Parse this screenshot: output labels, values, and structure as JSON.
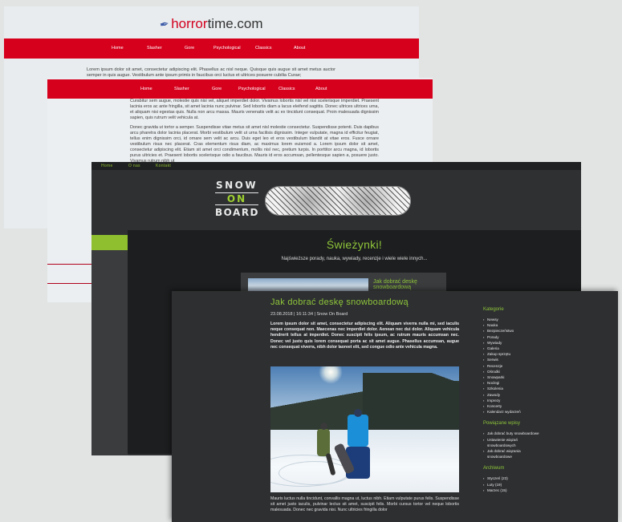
{
  "horror": {
    "logo_prefix": "horror",
    "logo_suffix": "time.com",
    "nav": [
      "Home",
      "Slasher",
      "Gore",
      "Psychological",
      "Classics",
      "About"
    ],
    "paragraph_1": "Lorem ipsum dolor sit amet, consectetur adipiscing elit. Phasellus ac nisl neque. Quisque quis augue sit amet metus auctor semper in quis augue. Vestibulum ante ipsum primis in faucibus orci luctus et ultrices posuere cubilia Curae;",
    "paragraph_2": "Curabitur sem augue, molestie quis nisi vel, aliquet imperdiet dolor. Vivamus lobortis nisl vel nisi scelerisque imperdiet. Praesent lacinia eros ac ante fringilla, sit amet lacinia nunc pulvinar. Sed lobortis diam a lacus eleifend sagittis. Donec ultrices ultrices urna, et aliquam nisi egestas quis. Nulla non arcu massa. Mauris venenatis velit ac ex tincidunt consequat. Proin malesuada dignissim sapien, quis rutrum velit vehicula at.",
    "paragraph_3": "Donec gravida ut tortor a semper. Suspendisse vitae metus sit amet nisl molestie consectetur. Suspendisse potenti. Duis dapibus arcu pharetra dolor lacinia placerat. Morbi vestibulum velit ut urna facilisis dignissim. Integer vulputate, magna id efficitur feugiat, tellus enim dignissim orci, id ornare sem velit ac arcu. Duis eget leo et eros vestibulum blandit at vitae eros. Fusce ornare vestibulum risus nec placerat. Cras elementum risus diam, ac maximus lorem euismod a. Lorem ipsum dolor sit amet, consectetur adipiscing elit. Etiam sit amet orci condimentum, mollis nisl nec, pretium turpis. In porttitor arcu magna, id lobortis purus ultricies et. Praesent lobortis scelerisque odio a faucibus. Mauris id eros accumsan, pellentesque sapien a, posuere justo. Vivamus rutrum nibh ut"
  },
  "snow": {
    "topnav": [
      "Home",
      "O nas",
      "Kontakt"
    ],
    "logo_line1": "SNOW",
    "logo_line2": "ON",
    "logo_line3": "BOARD"
  },
  "swiezynki": {
    "title": "Świeżynki!",
    "subtitle": "Najświeższe porady, nauka, wywiady, recenzje i wiele wiele innych...",
    "card_title": "Jak dobrać deskę snowboardową"
  },
  "article": {
    "title": "Jak dobrać deskę snowboardową",
    "meta": "23.08.2018 | 16:11:34 | Snow On Board",
    "lead": "Lorem ipsum dolor sit amet, consectetur adipiscing elit. Aliquam viverra nulla mi, sed iaculis neque consequat non. Maecenas nec imperdiet dolor. Aenean nec dui dolor. Aliquam vehicula hendrerit tellus at imperdiet. Donec suscipit felis ipsum, ac rutrum mauris accumsan nec. Donec vel justo quis lorem consequat porta ac sit amet augue. Phasellus accumsan, augue nec consequat viverra, nibh dolor laoreet elit, sed congue odio ante vehicula magna.",
    "body": "Mauris luctus nulla tincidunt, convallis magna ut, luctus nibh. Etiam vulputate purus felis. Suspendisse sit amet justo iaculis, pulvinar lectus sit amet, suscipit felis. Morbi cursus tortor vel neque lobortis malesuada. Donec nec gravida nisi. Nunc ultricies fringilla dolor"
  },
  "sidebar": {
    "categories_heading": "Kategorie",
    "categories": [
      "Newsy",
      "Nauka",
      "Bezpieczeństwo",
      "Porady",
      "Wywiady",
      "Galeria",
      "Zakup sprzętu",
      "Serwis",
      "Recenzje",
      "Ośrodki",
      "Snowparki",
      "Noclegi",
      "Szkolenia",
      "Zawody",
      "Imprezy",
      "Koncerty",
      "Kalendarz wydarzeń"
    ],
    "related_heading": "Powiązane wpisy",
    "related": [
      "Jak dobrać buty snowboardowe",
      "Ustawienie wiązań snowboardowych",
      "Jak dobrać wiązania snowboardowe"
    ],
    "archive_heading": "Archiwum",
    "archive": [
      "Styczeń (23)",
      "Luty (19)",
      "Marzec (15)"
    ]
  },
  "colors": {
    "horror_red": "#d6001c",
    "snow_green": "#8fc53a",
    "dark_bg": "#2d2f31"
  }
}
